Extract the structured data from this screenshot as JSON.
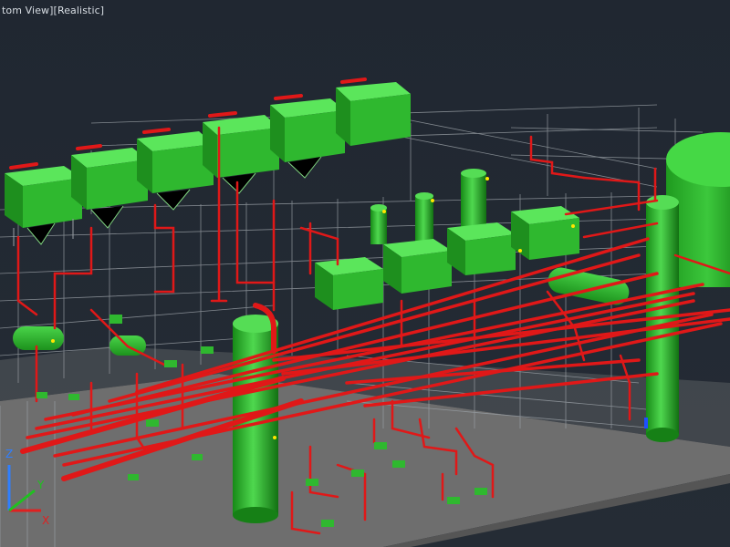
{
  "viewport": {
    "label": "tom View][Realistic]"
  },
  "ucs": {
    "z_label": "Z",
    "y_label": "Y",
    "x_label": "X"
  },
  "colors": {
    "background": "#222932",
    "slab": "#6e6e6e",
    "pipe": "#e01818",
    "equipment": "#1fae1f",
    "equipment_light": "#45d845",
    "wireframe": "#9aa0a6"
  }
}
